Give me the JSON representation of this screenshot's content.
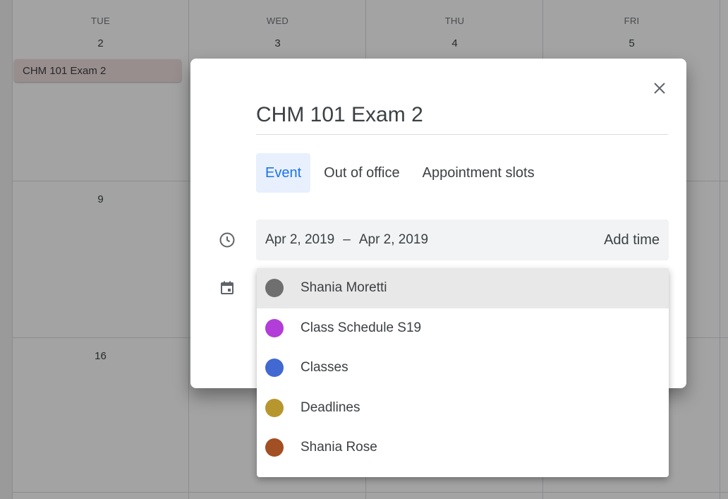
{
  "calendar": {
    "days": [
      {
        "dow": "TUE",
        "num": "2"
      },
      {
        "dow": "WED",
        "num": "3"
      },
      {
        "dow": "THU",
        "num": "4"
      },
      {
        "dow": "FRI",
        "num": "5"
      }
    ],
    "week2_first": "9",
    "week3_first": "16",
    "event_chip": "CHM 101 Exam 2"
  },
  "dialog": {
    "title_value": "CHM 101 Exam 2",
    "tabs": [
      {
        "label": "Event",
        "active": true
      },
      {
        "label": "Out of office",
        "active": false
      },
      {
        "label": "Appointment slots",
        "active": false
      }
    ],
    "start_date": "Apr 2, 2019",
    "dash": "–",
    "end_date": "Apr 2, 2019",
    "add_time_label": "Add time",
    "icons": {
      "time": "clock-icon",
      "calendar": "calendar-icon",
      "close": "close-icon"
    }
  },
  "calendar_dropdown": {
    "options": [
      {
        "label": "Shania Moretti",
        "color": "#6f6f6f"
      },
      {
        "label": "Class Schedule S19",
        "color": "#b23dd8"
      },
      {
        "label": "Classes",
        "color": "#4169d1"
      },
      {
        "label": "Deadlines",
        "color": "#b8962e"
      },
      {
        "label": "Shania Rose",
        "color": "#a34f24"
      }
    ]
  }
}
